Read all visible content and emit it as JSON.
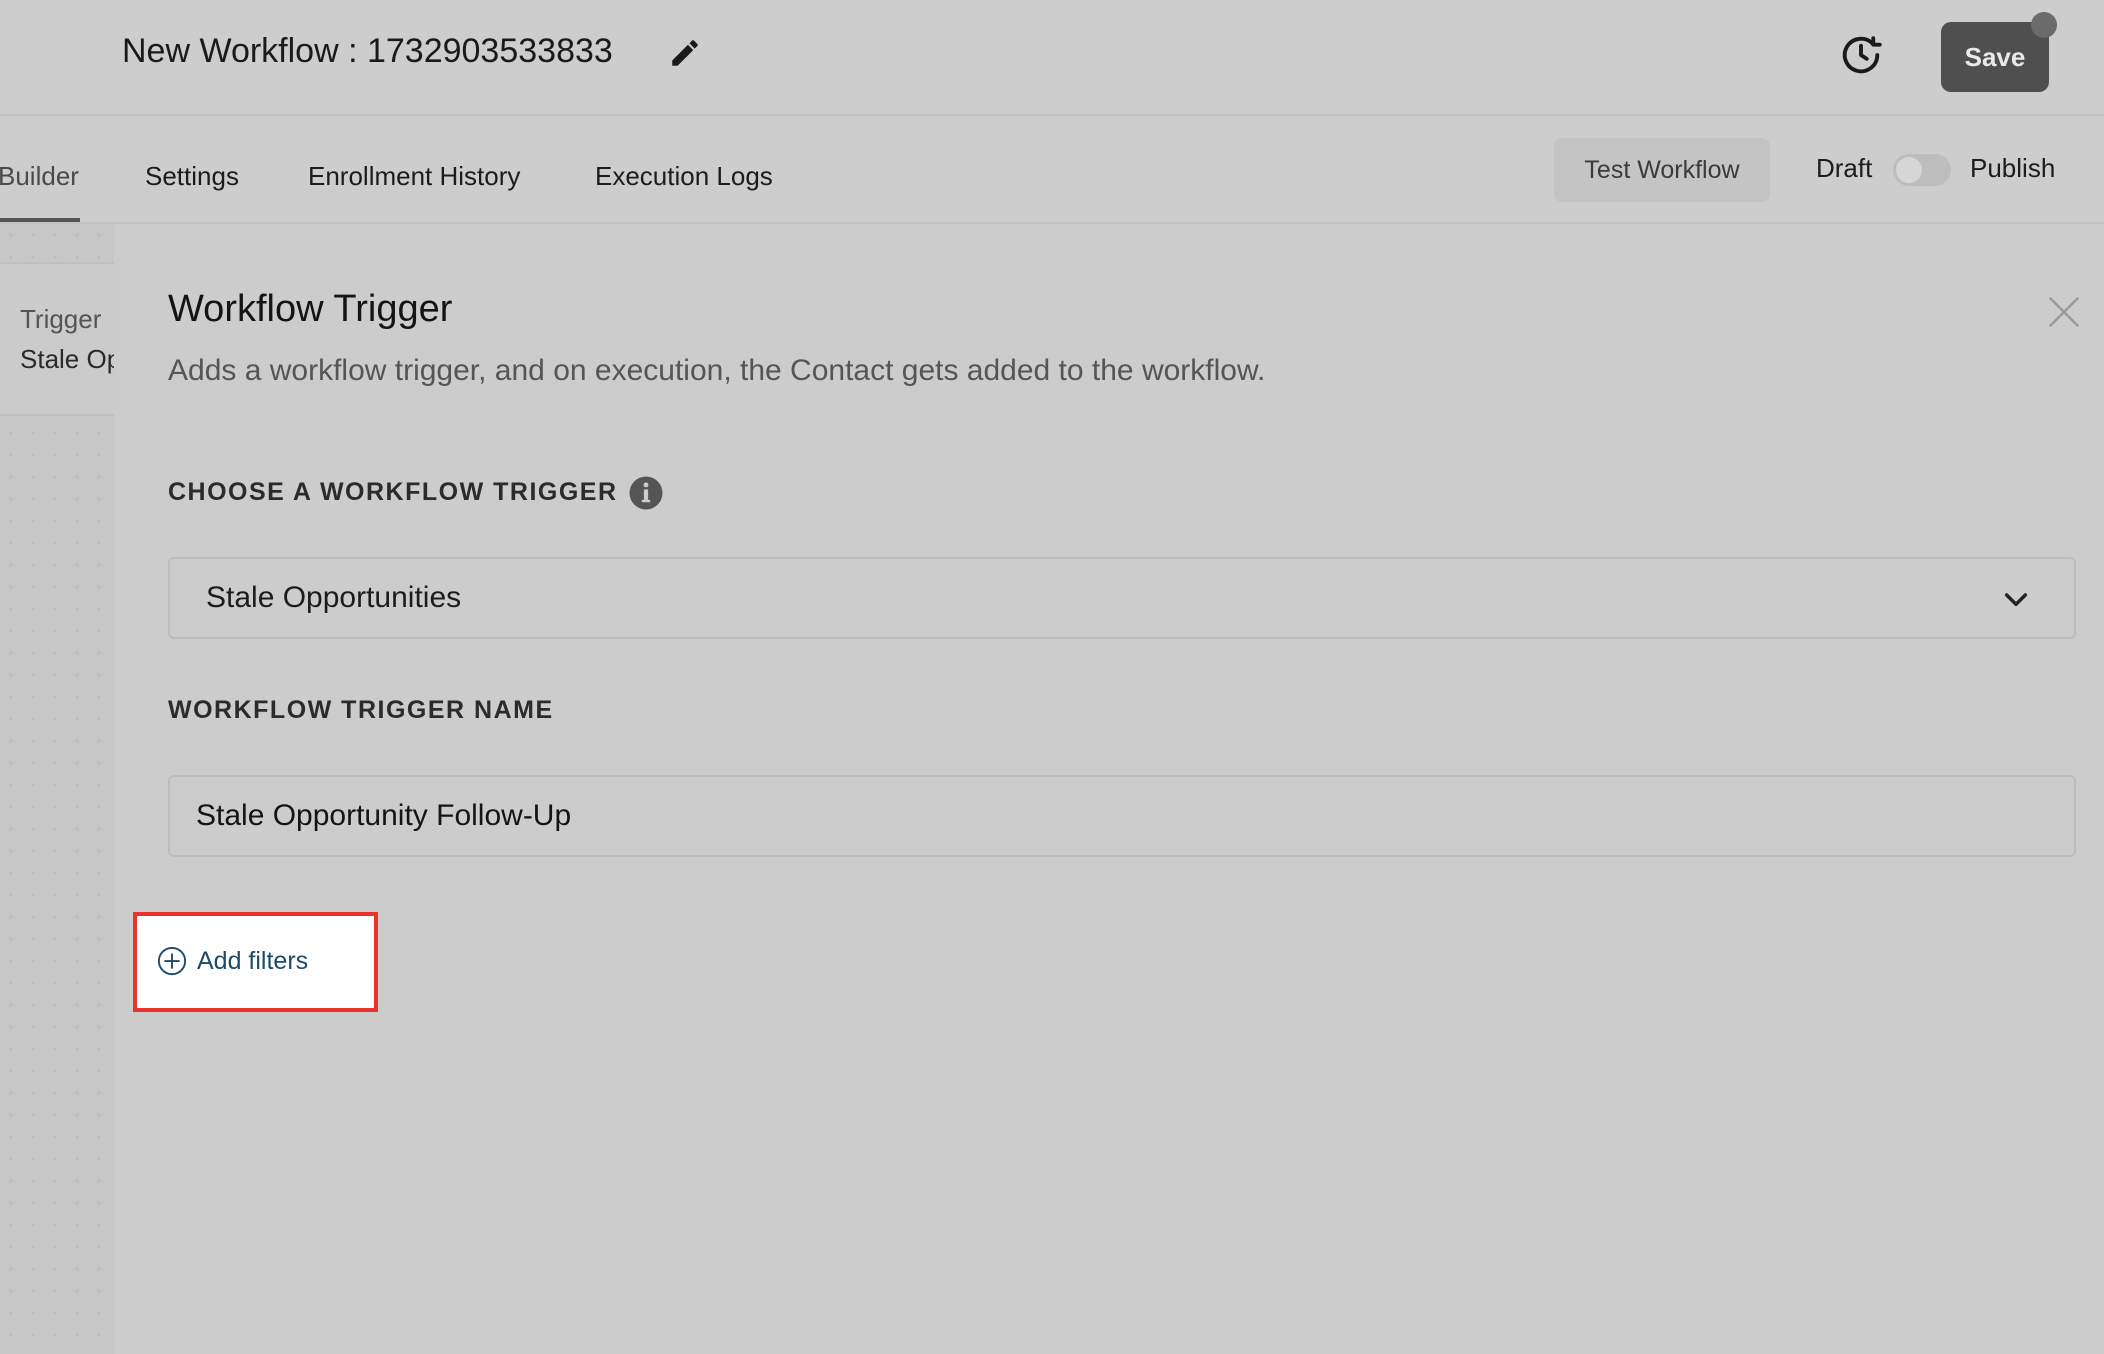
{
  "header": {
    "title": "New Workflow : 1732903533833",
    "save_label": "Save"
  },
  "tabs": [
    {
      "label": "Builder",
      "active": true
    },
    {
      "label": "Settings",
      "active": false
    },
    {
      "label": "Enrollment History",
      "active": false
    },
    {
      "label": "Execution Logs",
      "active": false
    }
  ],
  "toolbar": {
    "test_label": "Test Workflow",
    "draft_label": "Draft",
    "publish_label": "Publish",
    "published": false
  },
  "canvas": {
    "trigger_card_title": "Trigger",
    "trigger_card_subtitle": "Stale Opportunities"
  },
  "panel": {
    "title": "Workflow Trigger",
    "description": "Adds a workflow trigger, and on execution, the Contact gets added to the workflow.",
    "choose_label": "CHOOSE A WORKFLOW TRIGGER",
    "selected_trigger": "Stale Opportunities",
    "name_label": "WORKFLOW TRIGGER NAME",
    "trigger_name_value": "Stale Opportunity Follow-Up",
    "add_filters_label": "Add filters"
  },
  "colors": {
    "highlight": "#e8322b",
    "link": "#1d4a6b",
    "save_button": "#4f4f4f"
  },
  "icons": [
    "edit-icon",
    "history-icon",
    "close-icon",
    "info-icon",
    "chevron-down-icon",
    "plus-circle-icon"
  ]
}
